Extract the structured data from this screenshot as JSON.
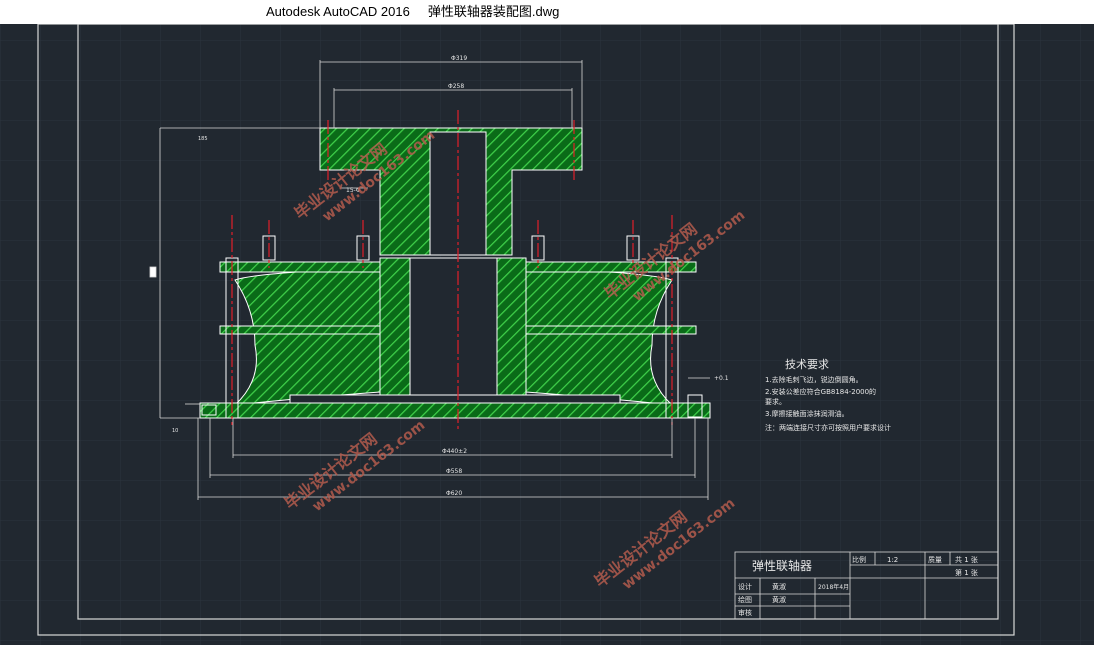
{
  "window": {
    "title": "Autodesk AutoCAD 2016     弹性联轴器装配图.dwg"
  },
  "drawing": {
    "dimensions": {
      "top_outer": "Φ319",
      "top_inner": "Φ258",
      "shaft_key": "15-Φ",
      "tol_note": "+0.1",
      "left_height": "185",
      "bottom_small": "10",
      "bottom_1": "Φ440±2",
      "bottom_2": "Φ558",
      "bottom_3": "Φ620"
    },
    "technical_requirements": {
      "heading": "技术要求",
      "lines": [
        "1.去除毛刺飞边，锐边倒圆角。",
        "2.安装公差应符合GB8184-2000的",
        "要求。",
        "3.摩擦接触面涂抹润滑油。",
        "注：两端连接尺寸亦可按照用户要求设计"
      ]
    },
    "title_block": {
      "name": "弹性联轴器",
      "scale_label": "比例",
      "scale_value": "1:2",
      "weight_label": "质量",
      "total_sheets": "共 1 张",
      "sheet_no": "第 1 张",
      "design_label": "设计",
      "design_name": "黄淑",
      "date": "2018年4月",
      "draw_label": "绘图",
      "draw_name": "黄淑",
      "review_label": "审核"
    },
    "watermarks": [
      {
        "cn": "毕业设计论文网",
        "url": "www.doc163.com"
      }
    ]
  }
}
